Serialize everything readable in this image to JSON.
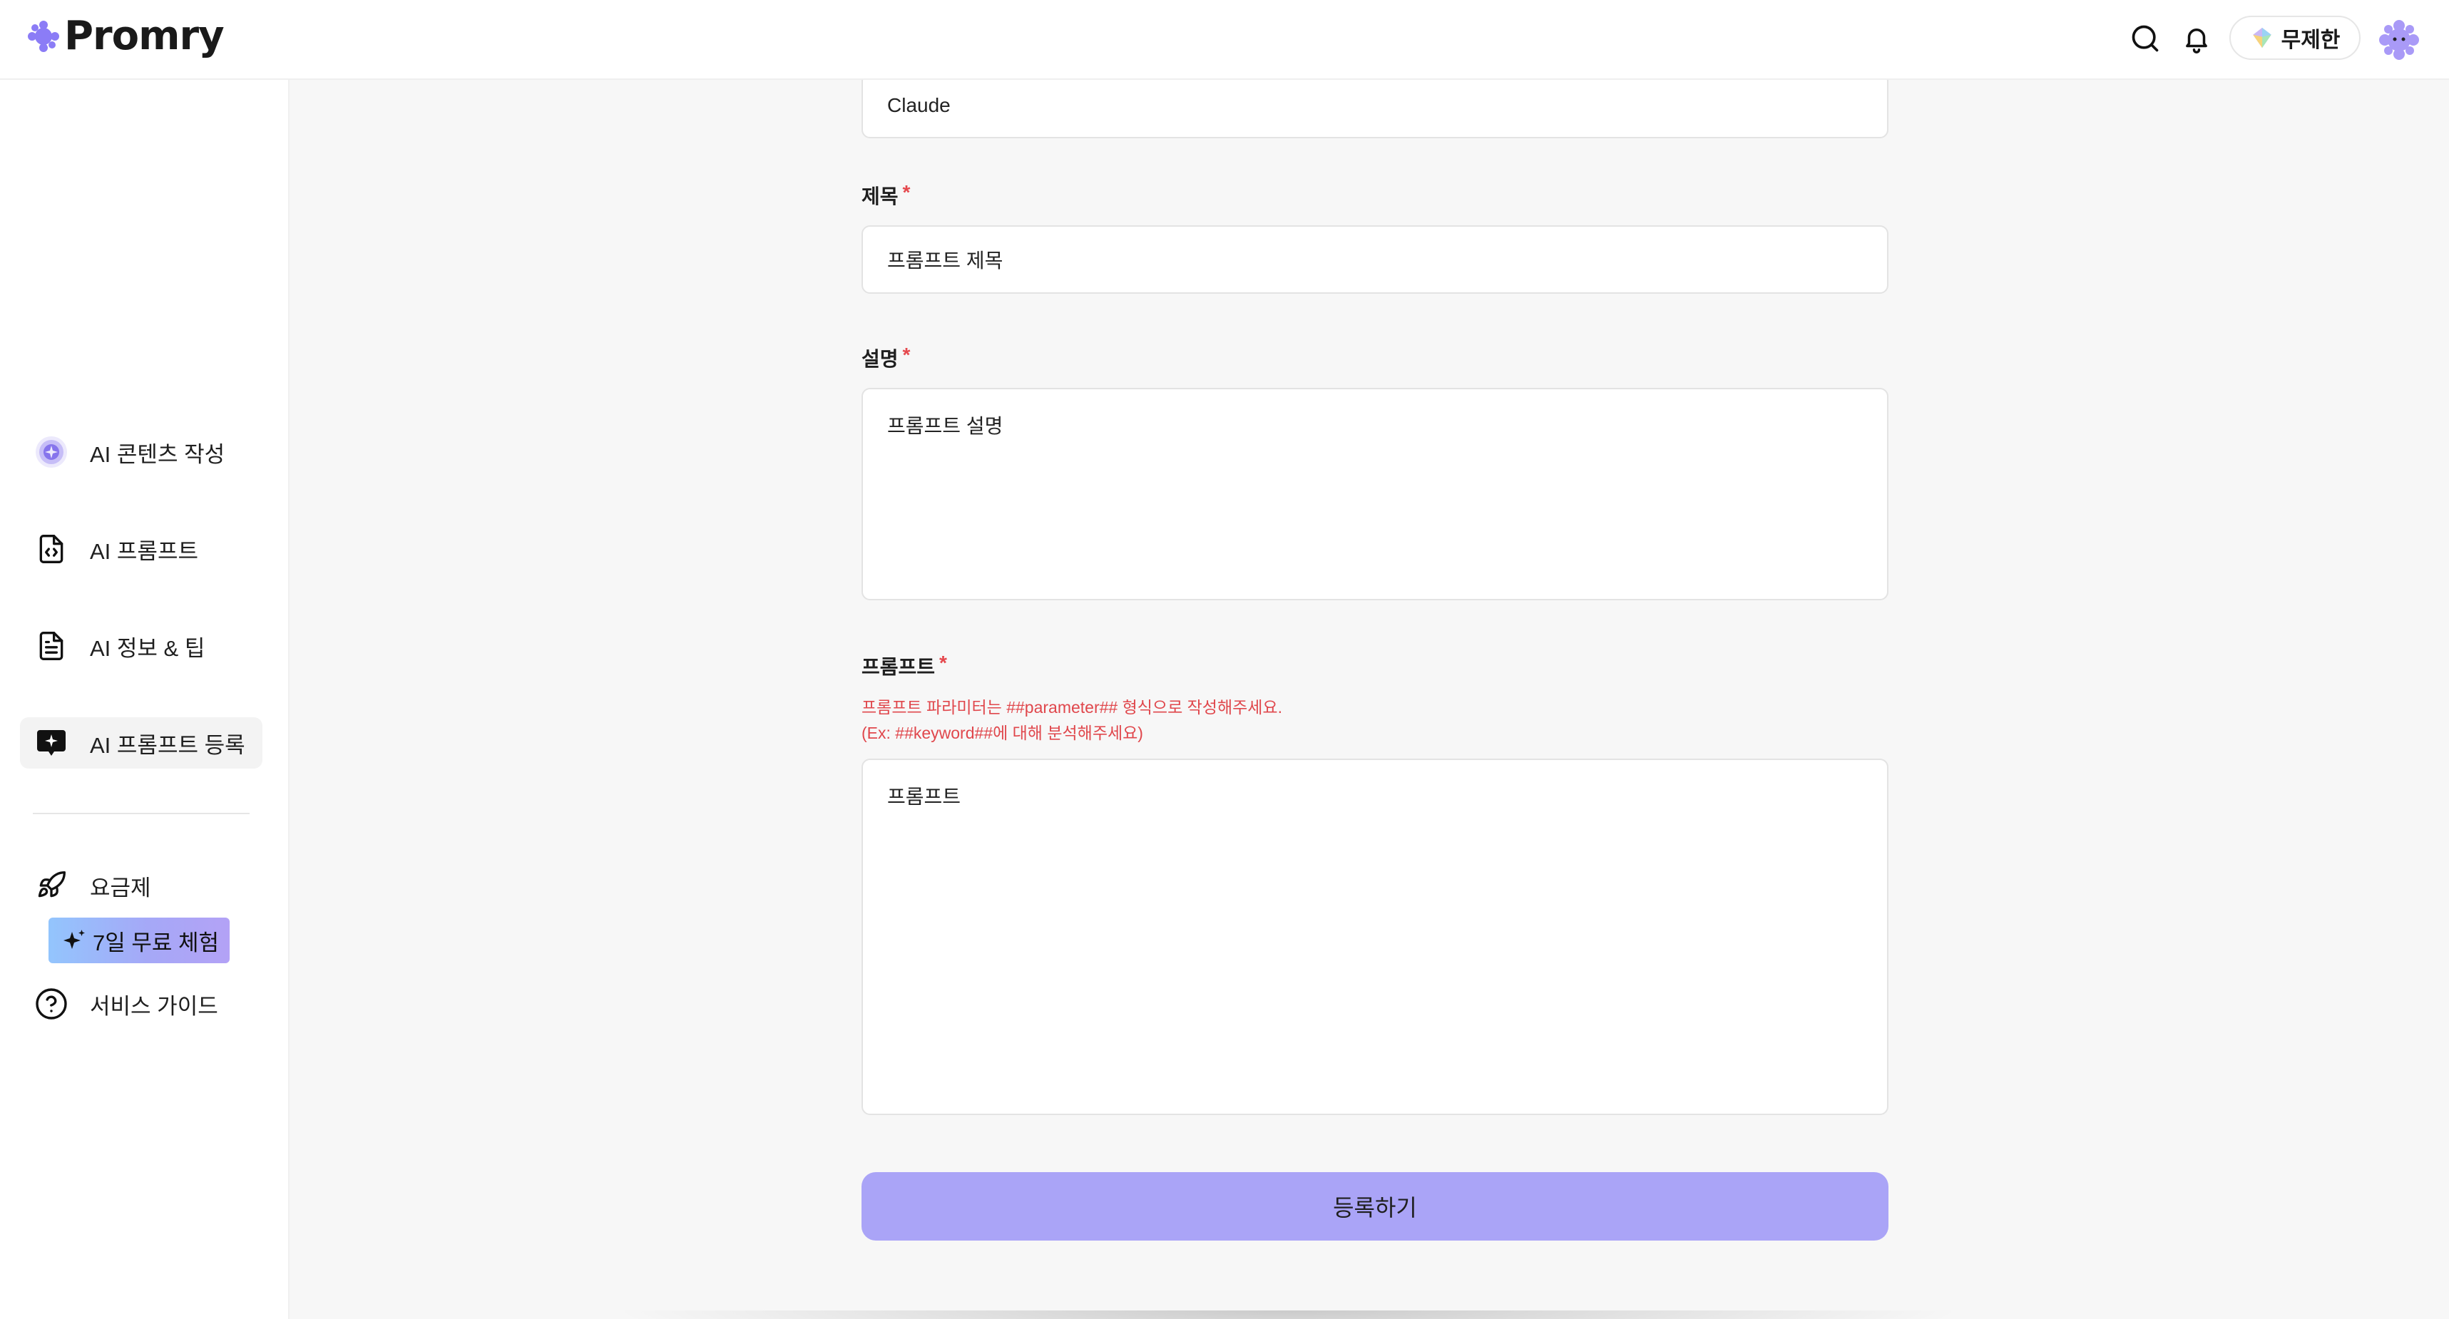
{
  "header": {
    "logo_text": "Promry",
    "plan_label": "무제한"
  },
  "sidebar": {
    "items": [
      {
        "label": "AI 콘텐츠 작성",
        "icon": "sparkle-circle-icon"
      },
      {
        "label": "AI 프롬프트",
        "icon": "code-file-icon"
      },
      {
        "label": "AI 정보 & 팁",
        "icon": "document-icon"
      },
      {
        "label": "AI 프롬프트 등록",
        "icon": "add-chat-icon",
        "active": true
      }
    ],
    "pricing_label": "요금제",
    "trial_badge": "7일 무료 체험",
    "guide_label": "서비스 가이드"
  },
  "form": {
    "model_value": "Claude",
    "title_label": "제목",
    "title_placeholder": "프롬프트 제목",
    "description_label": "설명",
    "description_placeholder": "프롬프트 설명",
    "prompt_label": "프롬프트",
    "prompt_hint_line1": "프롬프트 파라미터는 ##parameter## 형식으로 작성해주세요.",
    "prompt_hint_line2": "(Ex: ##keyword##에 대해 분석해주세요)",
    "prompt_placeholder": "프롬프트",
    "required_mark": "*",
    "submit_label": "등록하기"
  },
  "colors": {
    "accent": "#aaa4f7",
    "required": "#e5484d",
    "logo_purple": "#8b7cf6"
  }
}
